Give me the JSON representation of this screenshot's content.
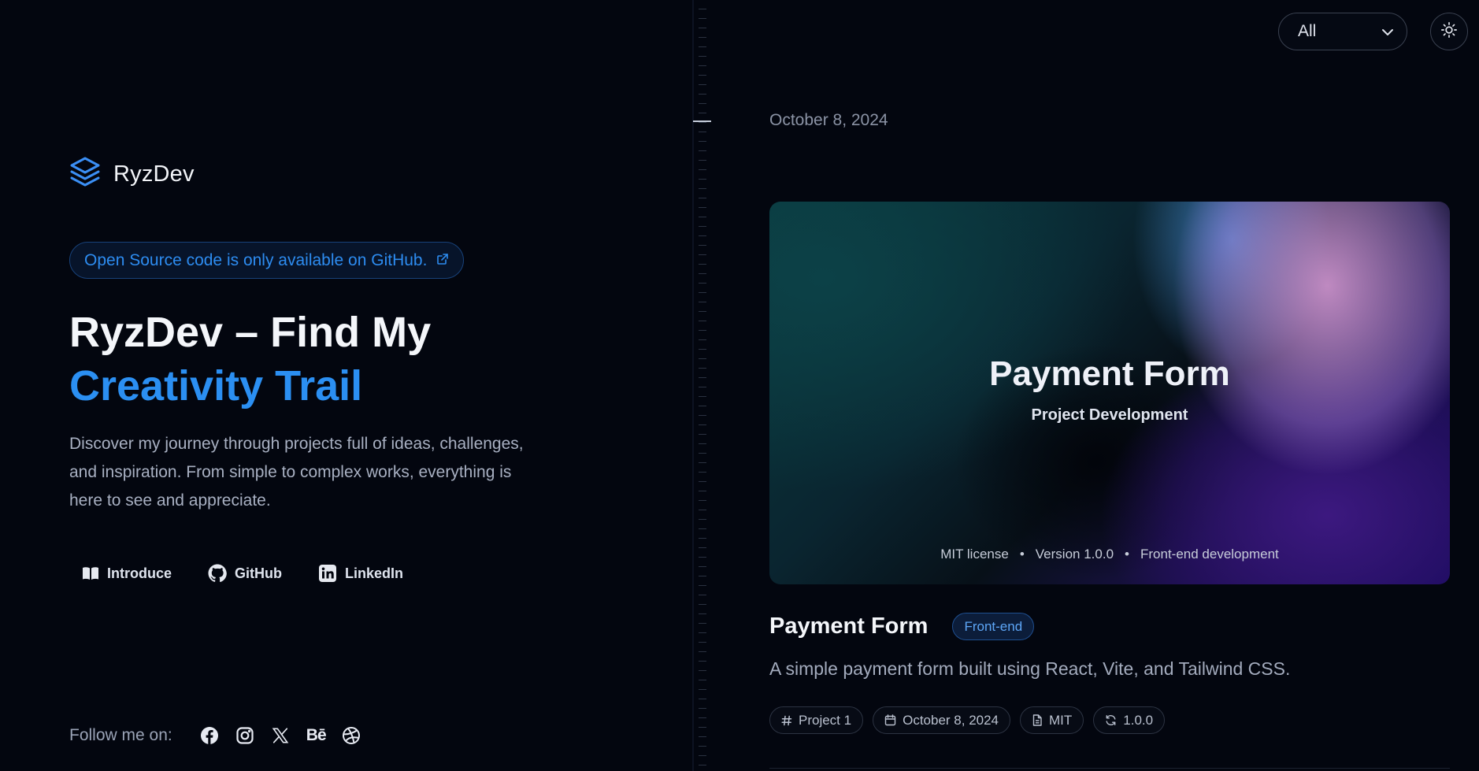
{
  "brand": {
    "name": "RyzDev"
  },
  "notice": {
    "text": "Open Source code is only available on GitHub."
  },
  "hero_section": {
    "headline_line1": "RyzDev – Find My",
    "headline_line2": "Creativity Trail",
    "intro": "Discover my journey through projects full of ideas, challenges, and inspiration. From simple to complex works, everything is here to see and appreciate."
  },
  "links": [
    {
      "label": "Introduce",
      "icon": "book-icon"
    },
    {
      "label": "GitHub",
      "icon": "github-icon"
    },
    {
      "label": "LinkedIn",
      "icon": "linkedin-icon"
    }
  ],
  "follow": {
    "label": "Follow me on:",
    "socials": [
      "facebook-icon",
      "instagram-icon",
      "x-icon",
      "behance-icon",
      "dribbble-icon"
    ],
    "behance_text": "Bē"
  },
  "controls": {
    "filter_value": "All",
    "theme_icon": "sun-icon"
  },
  "post": {
    "date": "October 8, 2024",
    "cover": {
      "title": "Payment Form",
      "subtitle": "Project Development",
      "meta": [
        "MIT license",
        "Version 1.0.0",
        "Front-end development"
      ],
      "separator": "•"
    },
    "title": "Payment Form",
    "category": "Front-end",
    "description": "A simple payment form built using React, Vite, and Tailwind CSS.",
    "tags": [
      {
        "label": "Project 1",
        "icon": "hash-icon"
      },
      {
        "label": "October 8, 2024",
        "icon": "calendar-icon"
      },
      {
        "label": "MIT",
        "icon": "file-icon"
      },
      {
        "label": "1.0.0",
        "icon": "refresh-icon"
      }
    ]
  },
  "colors": {
    "background": "#03060f",
    "accent": "#2b8ff2",
    "text": "#f4f6fa",
    "muted": "#a8b0c2"
  }
}
